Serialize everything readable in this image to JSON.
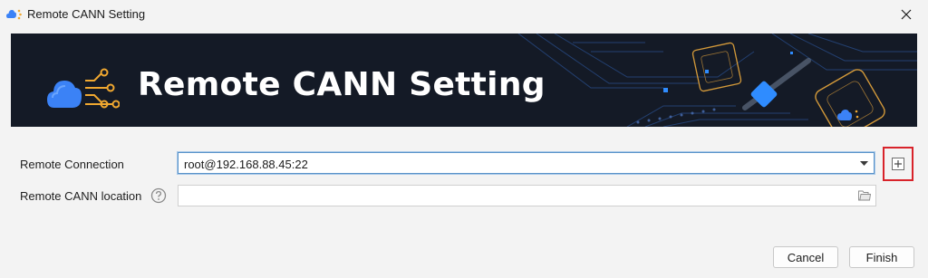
{
  "window": {
    "title": "Remote CANN Setting",
    "close_label": "✕"
  },
  "banner": {
    "title": "Remote CANN Setting"
  },
  "form": {
    "connection_label": "Remote Connection",
    "connection_value": "root@192.168.88.45:22",
    "location_label": "Remote CANN location",
    "location_value": "",
    "location_placeholder": ""
  },
  "buttons": {
    "cancel": "Cancel",
    "finish": "Finish"
  },
  "colors": {
    "banner_bg": "#141a26",
    "accent_gold": "#f0a830",
    "accent_blue": "#2f8cff",
    "highlight_border": "#d8232a"
  },
  "icons": {
    "app": "cloud-network-icon",
    "help": "question-circle-icon",
    "dropdown": "chevron-down-icon",
    "browse": "folder-icon",
    "add": "plus-square-icon",
    "close": "close-icon"
  }
}
